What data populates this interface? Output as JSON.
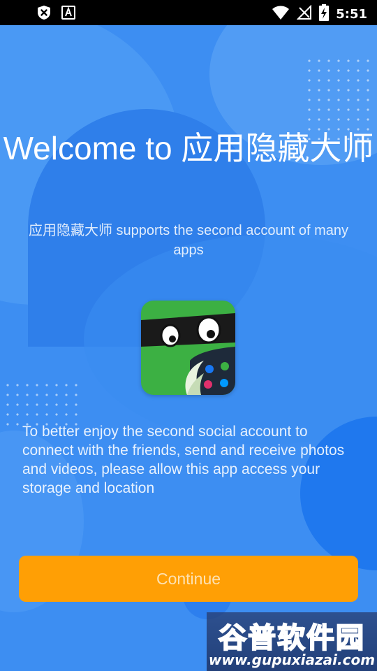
{
  "status_bar": {
    "time": "5:51",
    "left_icons": [
      "shield-x-icon",
      "a-box-icon"
    ],
    "right_icons": [
      "wifi-icon",
      "no-signal-icon",
      "battery-charging-icon"
    ]
  },
  "welcome": {
    "title": "Welcome to 应用隐藏大师",
    "subtitle": "应用隐藏大师 supports the second account of many apps",
    "description": "To better enjoy the second social account to connect with the friends, send and receive photos and videos, please allow this app access your storage and location",
    "continue_label": "Continue"
  },
  "watermark": {
    "title": "谷普软件园",
    "url": "www.gupuxiazai.com"
  },
  "colors": {
    "background": "#3d8ef2",
    "button": "#ff9f05",
    "button_text": "#fde2b3",
    "icon_green": "#3cb043"
  }
}
